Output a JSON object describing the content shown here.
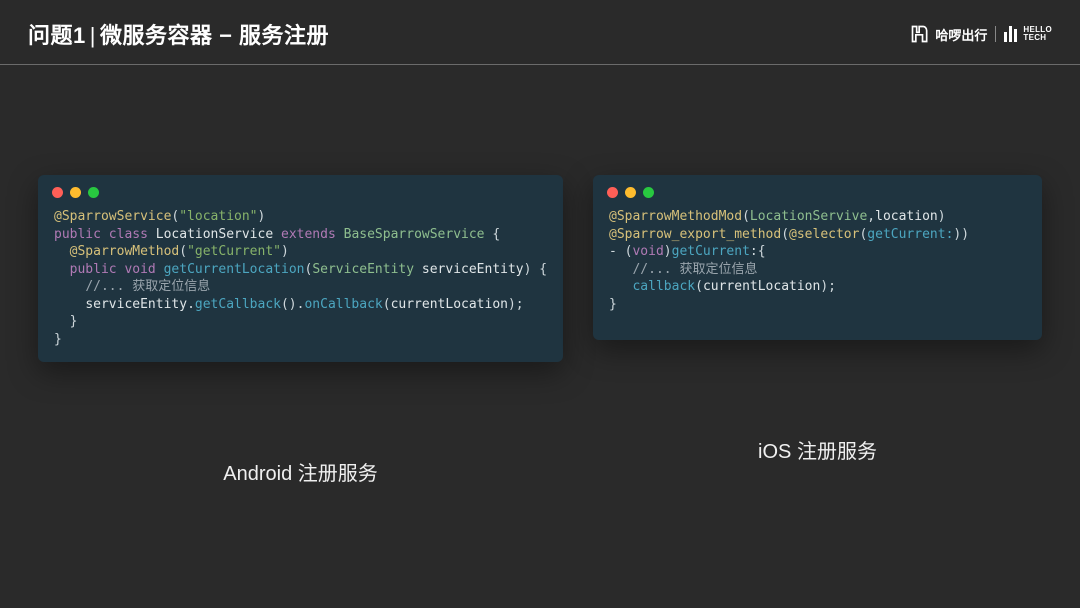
{
  "header": {
    "title_prefix": "问题1",
    "title_sep": "|",
    "title_main": "微服务容器 − 服务注册",
    "logo_cn": "哈啰出行",
    "logo_en_line1": "HELLO",
    "logo_en_line2": "TECH"
  },
  "left": {
    "caption": "Android 注册服务",
    "code": {
      "l1_ann": "@SparrowService",
      "l1_str": "\"location\"",
      "l2_kw1": "public",
      "l2_kw2": "class",
      "l2_name": "LocationService",
      "l2_ext": "extends",
      "l2_base": "BaseSparrowService",
      "l3_ann": "@SparrowMethod",
      "l3_str": "\"getCurrent\"",
      "l4_kw1": "public",
      "l4_kw2": "void",
      "l4_fn": "getCurrentLocation",
      "l4_ptype": "ServiceEntity",
      "l4_pname": "serviceEntity",
      "l5_cm": "//... 获取定位信息",
      "l6_a": "serviceEntity",
      "l6_b": "getCallback",
      "l6_c": "onCallback",
      "l6_d": "currentLocation"
    }
  },
  "right": {
    "caption": "iOS 注册服务",
    "code": {
      "l1_ann": "@SparrowMethodMod",
      "l1_a": "LocationServive",
      "l1_b": "location",
      "l2_ann": "@Sparrow_export_method",
      "l2_sel": "@selector",
      "l2_m": "getCurrent:",
      "l3_dash": "-",
      "l3_void": "void",
      "l3_fn": "getCurrent",
      "l4_cm": "//... 获取定位信息",
      "l5_a": "callback",
      "l5_b": "currentLocation"
    }
  }
}
